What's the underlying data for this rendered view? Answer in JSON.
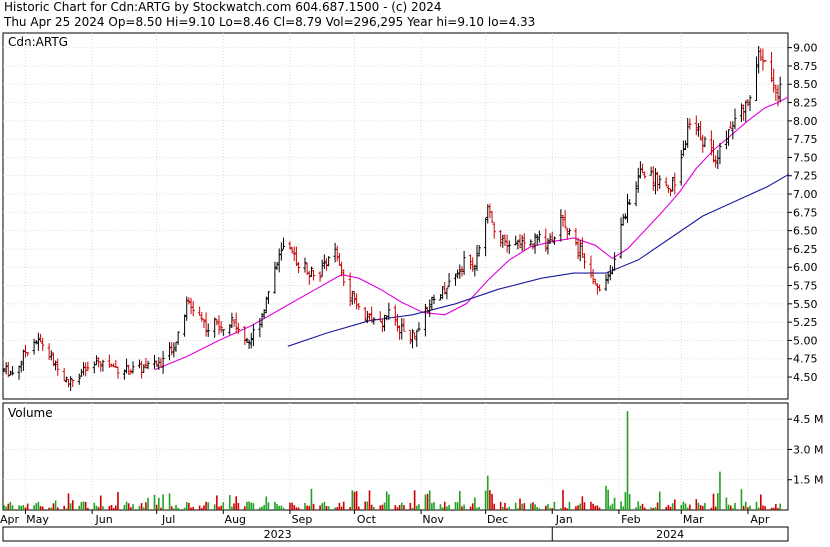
{
  "header": {
    "title": "Historic Chart for Cdn:ARTG by Stockwatch.com 604.687.1500 - (c) 2024",
    "quote": "Thu Apr 25 2024  Op=8.50  Hi=9.10  Lo=8.46  Cl=8.79  Vol=296,295  Year hi=9.10  lo=4.33"
  },
  "chart_data": [
    {
      "type": "ohlc",
      "symbol_label": "Cdn:ARTG",
      "ylim": [
        4.2,
        9.2
      ],
      "yticks": [
        "4.50",
        "4.75",
        "5.00",
        "5.25",
        "5.50",
        "5.75",
        "6.00",
        "6.25",
        "6.50",
        "6.75",
        "7.00",
        "7.25",
        "7.50",
        "7.75",
        "8.00",
        "8.25",
        "8.50",
        "8.75",
        "9.00"
      ],
      "x_months": [
        "Apr",
        "May",
        "Jun",
        "Jul",
        "Aug",
        "Sep",
        "Oct",
        "Nov",
        "Dec",
        "Jan",
        "Feb",
        "Mar",
        "Apr"
      ],
      "x_years": [
        "2023",
        "2024"
      ],
      "colors": {
        "up": "#000000",
        "down": "#cc0000",
        "ma_short": "#e000e0",
        "ma_long": "#1a1aa0"
      },
      "keypoints": [
        [
          0,
          4.6
        ],
        [
          5,
          4.55
        ],
        [
          10,
          4.85
        ],
        [
          14,
          5.0
        ],
        [
          18,
          4.95
        ],
        [
          22,
          4.75
        ],
        [
          26,
          4.55
        ],
        [
          30,
          4.42
        ],
        [
          35,
          4.55
        ],
        [
          40,
          4.62
        ],
        [
          45,
          4.7
        ],
        [
          50,
          4.65
        ],
        [
          55,
          4.6
        ],
        [
          60,
          4.6
        ],
        [
          65,
          4.62
        ],
        [
          70,
          4.65
        ],
        [
          75,
          4.75
        ],
        [
          78,
          4.9
        ],
        [
          82,
          5.1
        ],
        [
          85,
          5.5
        ],
        [
          88,
          5.45
        ],
        [
          91,
          5.35
        ],
        [
          95,
          5.15
        ],
        [
          98,
          5.25
        ],
        [
          102,
          5.2
        ],
        [
          106,
          5.3
        ],
        [
          110,
          5.1
        ],
        [
          114,
          5.0
        ],
        [
          118,
          5.2
        ],
        [
          122,
          5.55
        ],
        [
          126,
          6.0
        ],
        [
          130,
          6.25
        ],
        [
          134,
          6.15
        ],
        [
          138,
          6.05
        ],
        [
          142,
          5.95
        ],
        [
          146,
          5.85
        ],
        [
          150,
          6.1
        ],
        [
          153,
          6.3
        ],
        [
          156,
          6.0
        ],
        [
          159,
          5.7
        ],
        [
          163,
          5.6
        ],
        [
          167,
          5.4
        ],
        [
          171,
          5.25
        ],
        [
          175,
          5.2
        ],
        [
          179,
          5.35
        ],
        [
          183,
          5.2
        ],
        [
          187,
          5.1
        ],
        [
          191,
          5.05
        ],
        [
          194,
          5.2
        ],
        [
          197,
          5.45
        ],
        [
          200,
          5.55
        ],
        [
          203,
          5.65
        ],
        [
          207,
          5.8
        ],
        [
          211,
          5.95
        ],
        [
          215,
          6.1
        ],
        [
          219,
          6.05
        ],
        [
          222,
          6.45
        ],
        [
          225,
          6.75
        ],
        [
          228,
          6.55
        ],
        [
          232,
          6.4
        ],
        [
          236,
          6.2
        ],
        [
          240,
          6.35
        ],
        [
          244,
          6.3
        ],
        [
          248,
          6.4
        ],
        [
          252,
          6.35
        ],
        [
          256,
          6.45
        ],
        [
          260,
          6.7
        ],
        [
          263,
          6.5
        ],
        [
          266,
          6.3
        ],
        [
          269,
          6.2
        ],
        [
          272,
          6.05
        ],
        [
          275,
          5.8
        ],
        [
          278,
          5.7
        ],
        [
          281,
          5.9
        ],
        [
          284,
          6.1
        ],
        [
          286,
          6.4
        ],
        [
          288,
          6.7
        ],
        [
          291,
          6.85
        ],
        [
          294,
          7.15
        ],
        [
          297,
          7.35
        ],
        [
          300,
          7.2
        ],
        [
          303,
          7.25
        ],
        [
          306,
          7.1
        ],
        [
          309,
          7.05
        ],
        [
          312,
          7.2
        ],
        [
          315,
          7.5
        ],
        [
          318,
          7.85
        ],
        [
          321,
          7.95
        ],
        [
          324,
          7.8
        ],
        [
          327,
          7.65
        ],
        [
          330,
          7.5
        ],
        [
          333,
          7.6
        ],
        [
          336,
          7.75
        ],
        [
          339,
          7.95
        ],
        [
          342,
          8.1
        ],
        [
          345,
          8.2
        ],
        [
          348,
          8.5
        ],
        [
          351,
          8.85
        ],
        [
          354,
          8.75
        ],
        [
          357,
          8.6
        ],
        [
          360,
          8.4
        ],
        [
          363,
          8.55
        ],
        [
          365,
          8.79
        ]
      ],
      "ma_short": [
        [
          70,
          4.6
        ],
        [
          85,
          4.78
        ],
        [
          100,
          5.0
        ],
        [
          115,
          5.2
        ],
        [
          130,
          5.45
        ],
        [
          145,
          5.7
        ],
        [
          157,
          5.9
        ],
        [
          165,
          5.85
        ],
        [
          175,
          5.7
        ],
        [
          185,
          5.52
        ],
        [
          195,
          5.38
        ],
        [
          205,
          5.35
        ],
        [
          215,
          5.5
        ],
        [
          225,
          5.82
        ],
        [
          235,
          6.1
        ],
        [
          245,
          6.28
        ],
        [
          255,
          6.35
        ],
        [
          265,
          6.4
        ],
        [
          275,
          6.3
        ],
        [
          283,
          6.12
        ],
        [
          290,
          6.25
        ],
        [
          298,
          6.5
        ],
        [
          306,
          6.75
        ],
        [
          314,
          7.02
        ],
        [
          322,
          7.35
        ],
        [
          330,
          7.6
        ],
        [
          338,
          7.8
        ],
        [
          346,
          8.0
        ],
        [
          354,
          8.18
        ],
        [
          360,
          8.25
        ],
        [
          365,
          8.33
        ]
      ],
      "ma_long": [
        [
          132,
          4.92
        ],
        [
          150,
          5.1
        ],
        [
          170,
          5.27
        ],
        [
          190,
          5.35
        ],
        [
          210,
          5.5
        ],
        [
          230,
          5.7
        ],
        [
          250,
          5.85
        ],
        [
          265,
          5.92
        ],
        [
          280,
          5.92
        ],
        [
          295,
          6.1
        ],
        [
          310,
          6.4
        ],
        [
          325,
          6.7
        ],
        [
          340,
          6.9
        ],
        [
          355,
          7.1
        ],
        [
          365,
          7.27
        ]
      ],
      "spikes": [
        [
          290,
          4.9
        ],
        [
          333,
          1.9
        ],
        [
          225,
          1.7
        ],
        [
          163,
          0.9
        ],
        [
          197,
          0.8
        ],
        [
          280,
          1.2
        ],
        [
          292,
          0.8
        ],
        [
          342,
          0.9
        ]
      ]
    },
    {
      "type": "bar",
      "title": "Volume",
      "ylim": [
        0,
        5.3
      ],
      "yticks": [
        "1.5 M",
        "3.0 M",
        "4.5 M"
      ],
      "ytick_values": [
        1.5,
        3.0,
        4.5
      ]
    }
  ]
}
